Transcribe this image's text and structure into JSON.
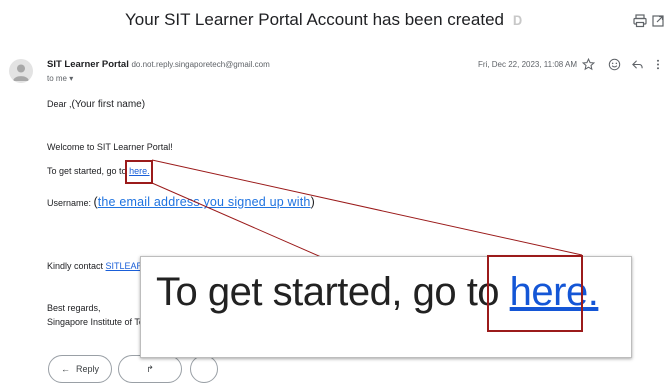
{
  "subject": "Your SIT Learner Portal Account has been created",
  "sender": {
    "name": "SIT Learner Portal",
    "email": "do.not.reply.singaporetech@gmail.com",
    "to": "to me ▾",
    "date": "Fri, Dec 22, 2023, 11:08 AM"
  },
  "body": {
    "greeting": "Dear ,",
    "name_placeholder": "(Your first name)",
    "welcome": "Welcome to SIT Learner Portal!",
    "get_started": "To get started, go to ",
    "here_link": "here.",
    "username_label": "Username: ",
    "username_open": "(",
    "email_placeholder": "the email address you signed up with",
    "username_close": ")",
    "contact": "Kindly contact ",
    "contact_link": "SITLEAR",
    "regards": "Best regards,",
    "signature": "Singapore Institute of Te"
  },
  "actions": {
    "reply": "Reply"
  },
  "zoom": {
    "text": "To get started, go to ",
    "link": "here."
  },
  "colors": {
    "annotation_red": "#9b1b1b",
    "link_blue": "#1a5fd8"
  }
}
